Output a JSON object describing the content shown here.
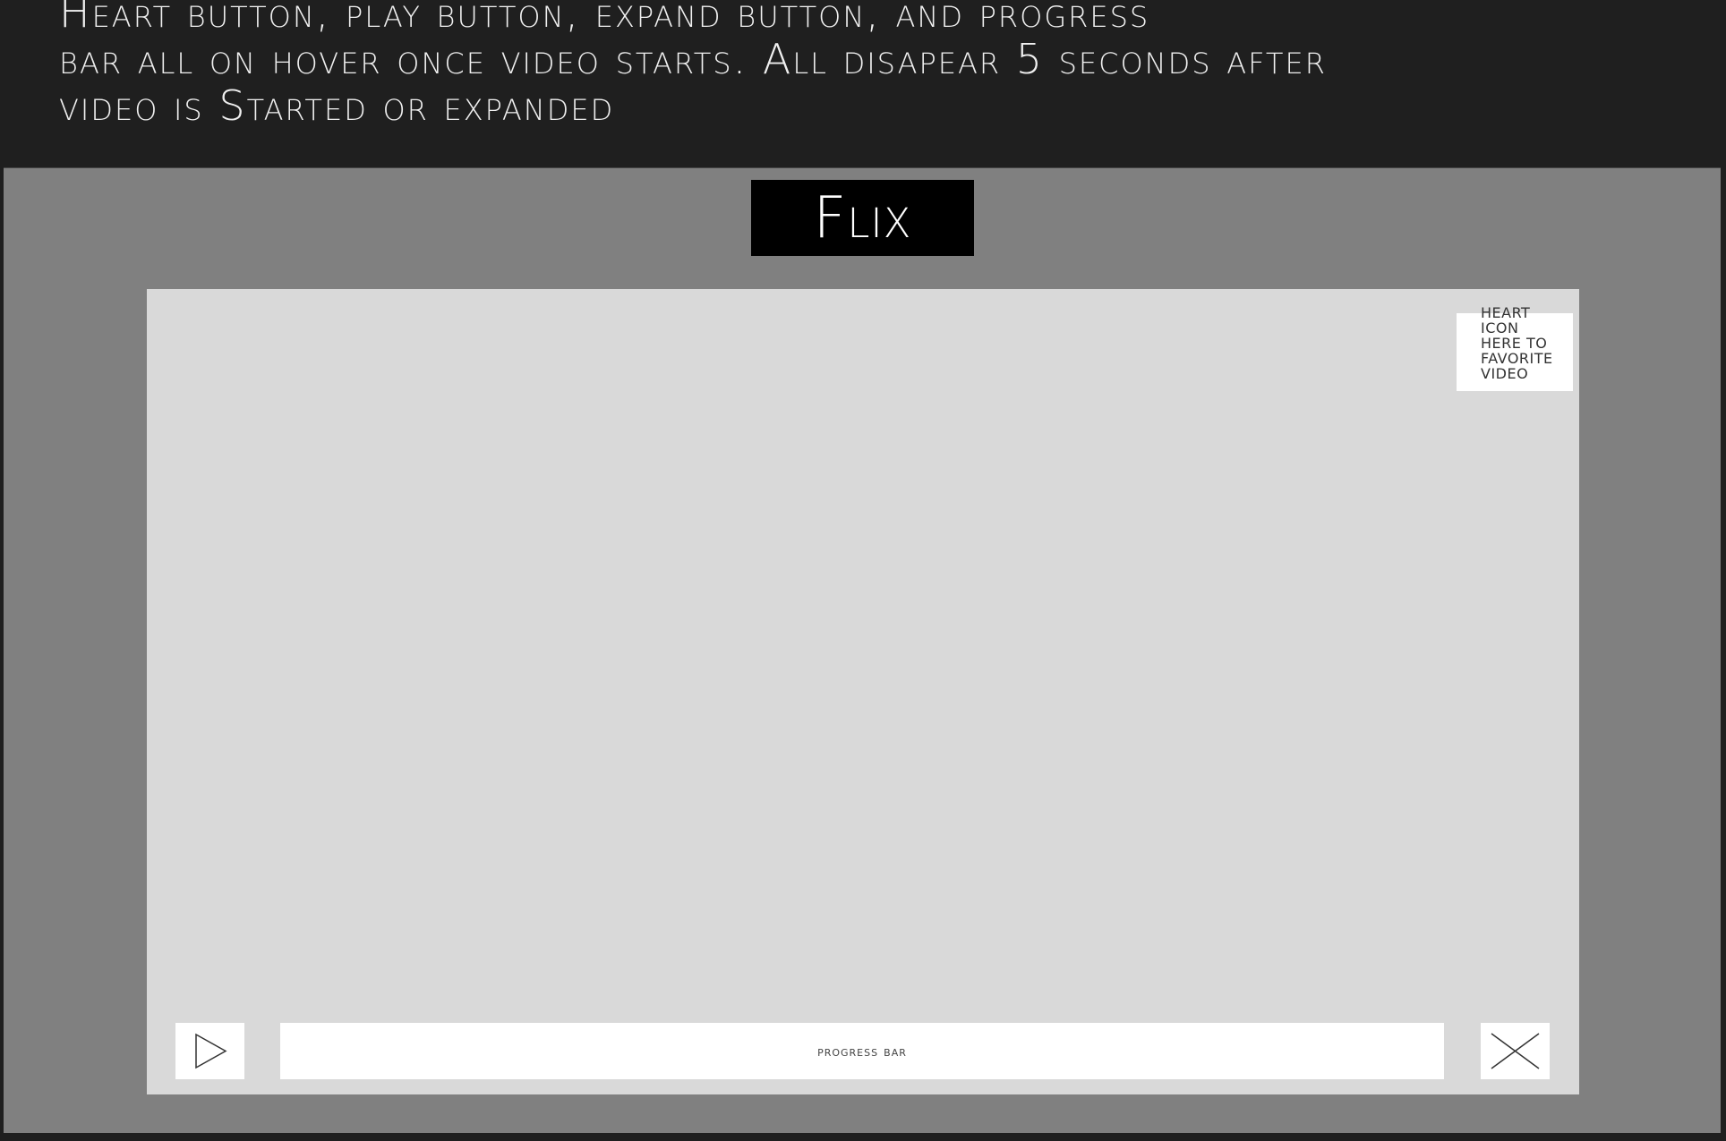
{
  "annotation": {
    "text": "Heart button, play button, expand button, and progress\nbar all on hover once video starts. All disapear 5 seconds after\nvideo is Started or expanded"
  },
  "logo": {
    "text": "Flix"
  },
  "video": {
    "heart_placeholder": "HEART ICON HERE TO FAVORITE VIDEO",
    "progress_label": "progress bar",
    "play_icon": "play-icon",
    "expand_icon": "close-x-icon"
  },
  "colors": {
    "header_bg": "#1f1f1f",
    "frame_bg": "#808080",
    "video_bg": "#d9d9d9",
    "logo_bg": "#000000",
    "control_bg": "#ffffff"
  }
}
